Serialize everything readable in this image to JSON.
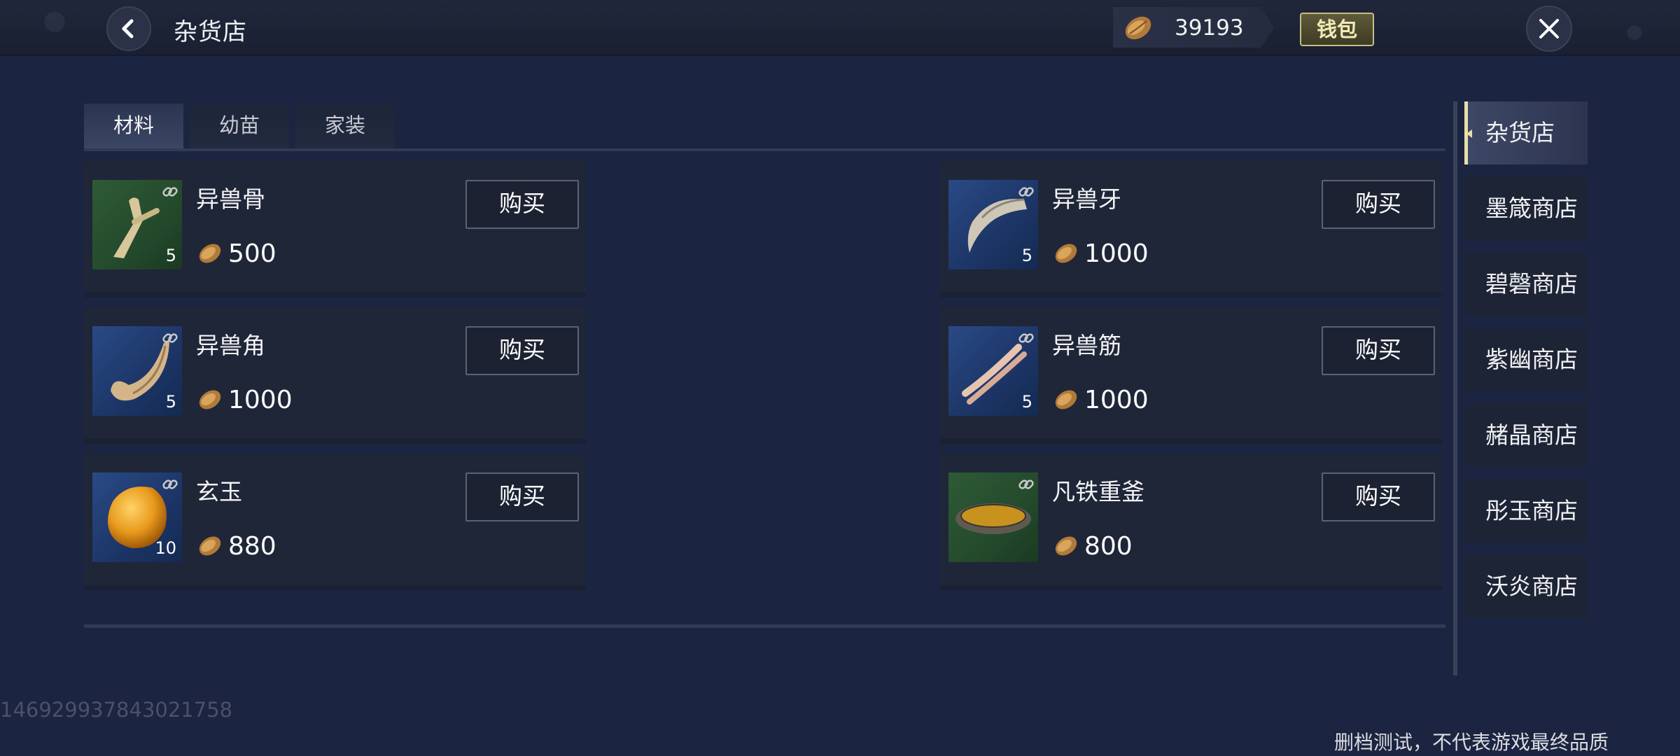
{
  "header": {
    "title": "杂货店",
    "currency_amount": "39193",
    "wallet_label": "钱包"
  },
  "tabs": [
    {
      "label": "材料",
      "active": true
    },
    {
      "label": "幼苗",
      "active": false
    },
    {
      "label": "家装",
      "active": false
    }
  ],
  "items": [
    {
      "name": "异兽骨",
      "qty": "5",
      "price": "500",
      "buy_label": "购买"
    },
    {
      "name": "异兽牙",
      "qty": "5",
      "price": "1000",
      "buy_label": "购买"
    },
    {
      "name": "异兽角",
      "qty": "5",
      "price": "1000",
      "buy_label": "购买"
    },
    {
      "name": "异兽筋",
      "qty": "5",
      "price": "1000",
      "buy_label": "购买"
    },
    {
      "name": "玄玉",
      "qty": "10",
      "price": "880",
      "buy_label": "购买"
    },
    {
      "name": "凡铁重釜",
      "qty": "",
      "price": "800",
      "buy_label": "购买"
    }
  ],
  "shops": [
    {
      "label": "杂货店",
      "active": true
    },
    {
      "label": "墨箴商店",
      "active": false
    },
    {
      "label": "碧磬商店",
      "active": false
    },
    {
      "label": "紫幽商店",
      "active": false
    },
    {
      "label": "赭晶商店",
      "active": false
    },
    {
      "label": "彤玉商店",
      "active": false
    },
    {
      "label": "沃炎商店",
      "active": false
    }
  ],
  "footer": {
    "uid": "1469299378430217​58",
    "disclaimer": "删档测试，不代表游戏最终品质"
  },
  "colors": {
    "background": "#1b2440",
    "accent": "#e8dfaa",
    "card": "#1f2638"
  },
  "icons": [
    "back-arrow-icon",
    "seed-currency-icon",
    "close-icon",
    "link-icon"
  ]
}
